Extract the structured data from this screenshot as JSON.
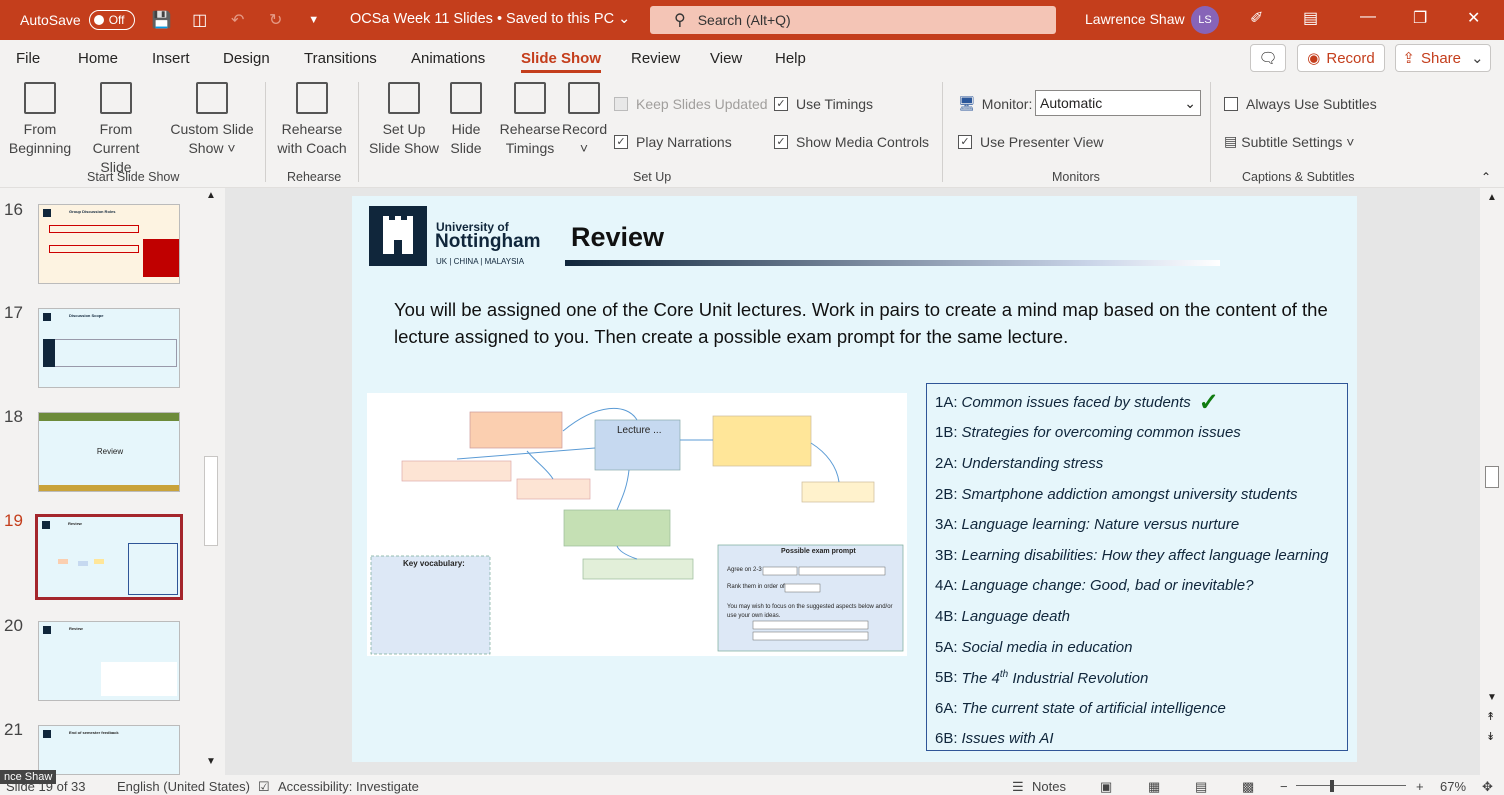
{
  "titlebar": {
    "autosave_label": "AutoSave",
    "autosave_state": "Off",
    "document_title": "OCSa Week 11 Slides • Saved to this PC",
    "search_placeholder": "Search (Alt+Q)",
    "user_name": "Lawrence Shaw",
    "user_initials": "LS"
  },
  "menu": {
    "tabs": [
      "File",
      "Home",
      "Insert",
      "Design",
      "Transitions",
      "Animations",
      "Slide Show",
      "Review",
      "View",
      "Help"
    ],
    "active_tab": "Slide Show",
    "record_label": "Record",
    "share_label": "Share"
  },
  "ribbon": {
    "start": {
      "from_beginning": [
        "From",
        "Beginning"
      ],
      "from_current": [
        "From",
        "Current Slide"
      ],
      "custom": [
        "Custom Slide",
        "Show ˅"
      ],
      "group_label": "Start Slide Show"
    },
    "rehearse": {
      "coach": [
        "Rehearse",
        "with Coach"
      ],
      "group_label": "Rehearse"
    },
    "setup": {
      "setup_show": [
        "Set Up",
        "Slide Show"
      ],
      "hide_slide": [
        "Hide",
        "Slide"
      ],
      "rehearse_timings": [
        "Rehearse",
        "Timings"
      ],
      "record": [
        "Record",
        "˅"
      ],
      "keep_updated": "Keep Slides Updated",
      "play_narrations": "Play Narrations",
      "use_timings": "Use Timings",
      "show_media_controls": "Show Media Controls",
      "group_label": "Set Up"
    },
    "monitors": {
      "monitor_label": "Monitor:",
      "monitor_value": "Automatic",
      "presenter_view": "Use Presenter View",
      "group_label": "Monitors"
    },
    "captions": {
      "always_subtitles": "Always Use Subtitles",
      "subtitle_settings": "Subtitle Settings ˅",
      "group_label": "Captions & Subtitles"
    }
  },
  "thumbnails": [
    {
      "number": "16",
      "title": "Group Discussion Roles",
      "active": false
    },
    {
      "number": "17",
      "title": "Discussion Scope",
      "active": false
    },
    {
      "number": "18",
      "title": "Review",
      "active": false
    },
    {
      "number": "19",
      "title": "Review",
      "active": true
    },
    {
      "number": "20",
      "title": "Review",
      "active": false
    },
    {
      "number": "21",
      "title": "End of semester feedback",
      "active": false
    }
  ],
  "slide": {
    "logo_line1": "University of",
    "logo_line2": "Nottingham",
    "logo_tag": "UK | CHINA | MALAYSIA",
    "title": "Review",
    "intro": "You will be assigned one of the Core Unit lectures. Work in pairs to create a mind map based on the content of the lecture assigned to you. Then create a possible exam prompt for the same lecture.",
    "mindmap": {
      "center_label": "Lecture ...",
      "vocab_label": "Key vocabulary:",
      "exam_title": "Possible exam prompt",
      "exam_line1": "Agree on 2-3",
      "exam_line2": "Rank them in order of",
      "exam_line3": "You may wish to focus on the suggested aspects below and/or use your own ideas."
    },
    "lectures": [
      {
        "code": "1A:",
        "name": "Common issues faced by students",
        "checked": true
      },
      {
        "code": "1B:",
        "name": "Strategies for overcoming common issues",
        "checked": false
      },
      {
        "code": "2A:",
        "name": "Understanding stress",
        "checked": false
      },
      {
        "code": "2B:",
        "name": "Smartphone addiction amongst university students",
        "checked": false
      },
      {
        "code": "3A:",
        "name": "Language learning: Nature versus nurture",
        "checked": false
      },
      {
        "code": "3B:",
        "name": "Learning disabilities: How they affect language learning",
        "checked": false
      },
      {
        "code": "4A:",
        "name": "Language change: Good, bad or inevitable?",
        "checked": false
      },
      {
        "code": "4B:",
        "name": "Language death",
        "checked": false
      },
      {
        "code": "5A:",
        "name": "Social media in education",
        "checked": false
      },
      {
        "code": "5B:",
        "name": "The 4th Industrial Revolution",
        "checked": false
      },
      {
        "code": "6A:",
        "name": "The current state of artificial intelligence",
        "checked": false
      },
      {
        "code": "6B:",
        "name": "Issues with AI",
        "checked": false
      }
    ]
  },
  "statusbar": {
    "slide_counter": "Slide 19 of 33",
    "language": "English (United States)",
    "accessibility": "Accessibility: Investigate",
    "notes": "Notes",
    "zoom": "67%",
    "tooltip": "nce Shaw"
  },
  "colors": {
    "accent": "#c43e1c",
    "slide_bg": "#e6f6fb",
    "navy": "#10263b"
  }
}
